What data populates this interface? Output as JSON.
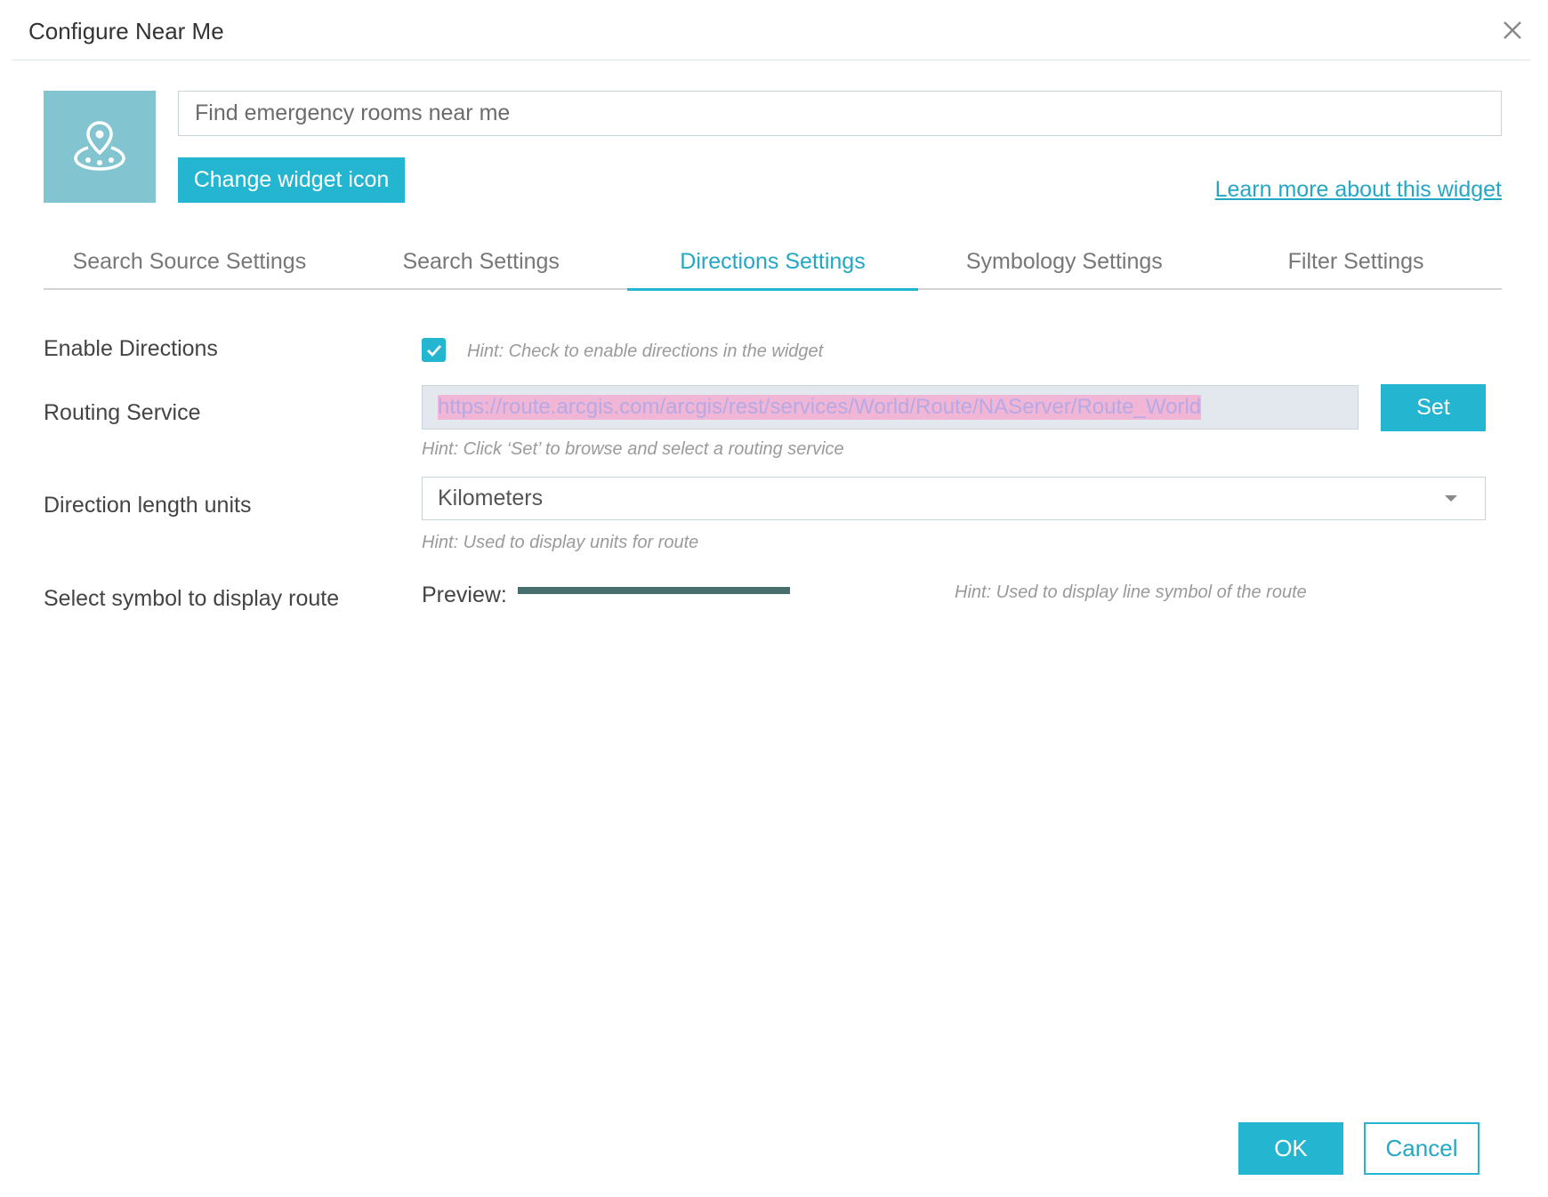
{
  "dialog": {
    "title": "Configure Near Me"
  },
  "widget": {
    "title_value": "Find emergency rooms near me",
    "change_icon_label": "Change widget icon",
    "learn_more_label": "Learn more about this widget",
    "icon": "map-pin-icon"
  },
  "tabs": [
    {
      "label": "Search Source Settings",
      "active": false
    },
    {
      "label": "Search Settings",
      "active": false
    },
    {
      "label": "Directions Settings",
      "active": true
    },
    {
      "label": "Symbology Settings",
      "active": false
    },
    {
      "label": "Filter Settings",
      "active": false
    }
  ],
  "form": {
    "enable_directions": {
      "label": "Enable Directions",
      "checked": true,
      "hint": "Hint: Check to enable directions in the widget"
    },
    "routing_service": {
      "label": "Routing Service",
      "value": "https://route.arcgis.com/arcgis/rest/services/World/Route/NAServer/Route_World",
      "set_label": "Set",
      "hint": "Hint: Click ‘Set’ to browse and select a routing service"
    },
    "length_units": {
      "label": "Direction length units",
      "selected": "Kilometers",
      "hint": "Hint: Used to display units for route"
    },
    "route_symbol": {
      "label": "Select symbol to display route",
      "preview_label": "Preview:",
      "line_color": "#466e6c",
      "hint": "Hint: Used to display line symbol of the route"
    }
  },
  "footer": {
    "ok_label": "OK",
    "cancel_label": "Cancel"
  },
  "colors": {
    "accent": "#24b5d0",
    "icon_tile": "#82c5d0"
  }
}
